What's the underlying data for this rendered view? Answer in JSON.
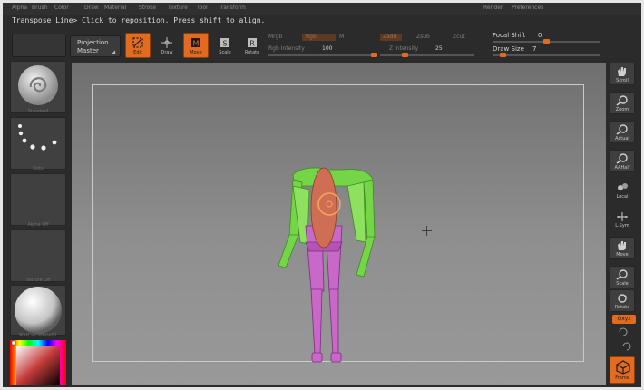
{
  "menu": [
    "Alpha",
    "Brush",
    "Color",
    "Draw",
    "Material",
    "Stroke",
    "Texture",
    "Tool",
    "Transform",
    "Render",
    "Preferences"
  ],
  "status_text": "Transpose Line> Click to reposition. Press shift to align.",
  "toolbar": {
    "projection_master": [
      "Projection",
      "Master"
    ],
    "edit_label": "Edit",
    "draw_label": "Draw",
    "move_label": "Move",
    "scale_label": "Scale",
    "rotate_label": "Rotate",
    "mrgb": "Mrgb",
    "rgb": "Rgb",
    "m": "M",
    "rgb_intensity_label": "Rgb Intensity",
    "rgb_intensity_value": "100",
    "zadd": "Zadd",
    "zsub": "Zsub",
    "zcut": "Zcut",
    "z_intensity_label": "Z Intensity",
    "z_intensity_value": "25",
    "focal_shift_label": "Focal Shift",
    "focal_shift_value": "0",
    "draw_size_label": "Draw Size",
    "draw_size_value": "7",
    "rgb_intensity_level": 1.0,
    "z_intensity_level": 0.25,
    "draw_size_level": 0.07,
    "focal_shift_level": 0.0
  },
  "left_shelf": {
    "brush_label": "Standard",
    "stroke_label": "Dots",
    "alpha_label": "Alpha Off",
    "texture_label": "Texture Off",
    "material_label": "MatCap White01"
  },
  "right_shelf": [
    "Scroll",
    "Zoom",
    "Actual",
    "AAHalf",
    "Local",
    "L.Sym",
    "Move",
    "Scale",
    "Rotate"
  ],
  "xyz_label": "Qxyz",
  "frame_label": "Frame",
  "colors": {
    "accent": "#e36b1f",
    "torso": "#cf6e55",
    "arms": "#74d646",
    "legs": "#c868c8",
    "viewport": "#858585"
  },
  "icons": {
    "edit": "transpose-line-icon",
    "draw": "draw-crosshair-icon",
    "move": "move-icon",
    "scale": "scale-icon",
    "rotate": "rotate-icon",
    "frame": "frame-cube-icon"
  }
}
